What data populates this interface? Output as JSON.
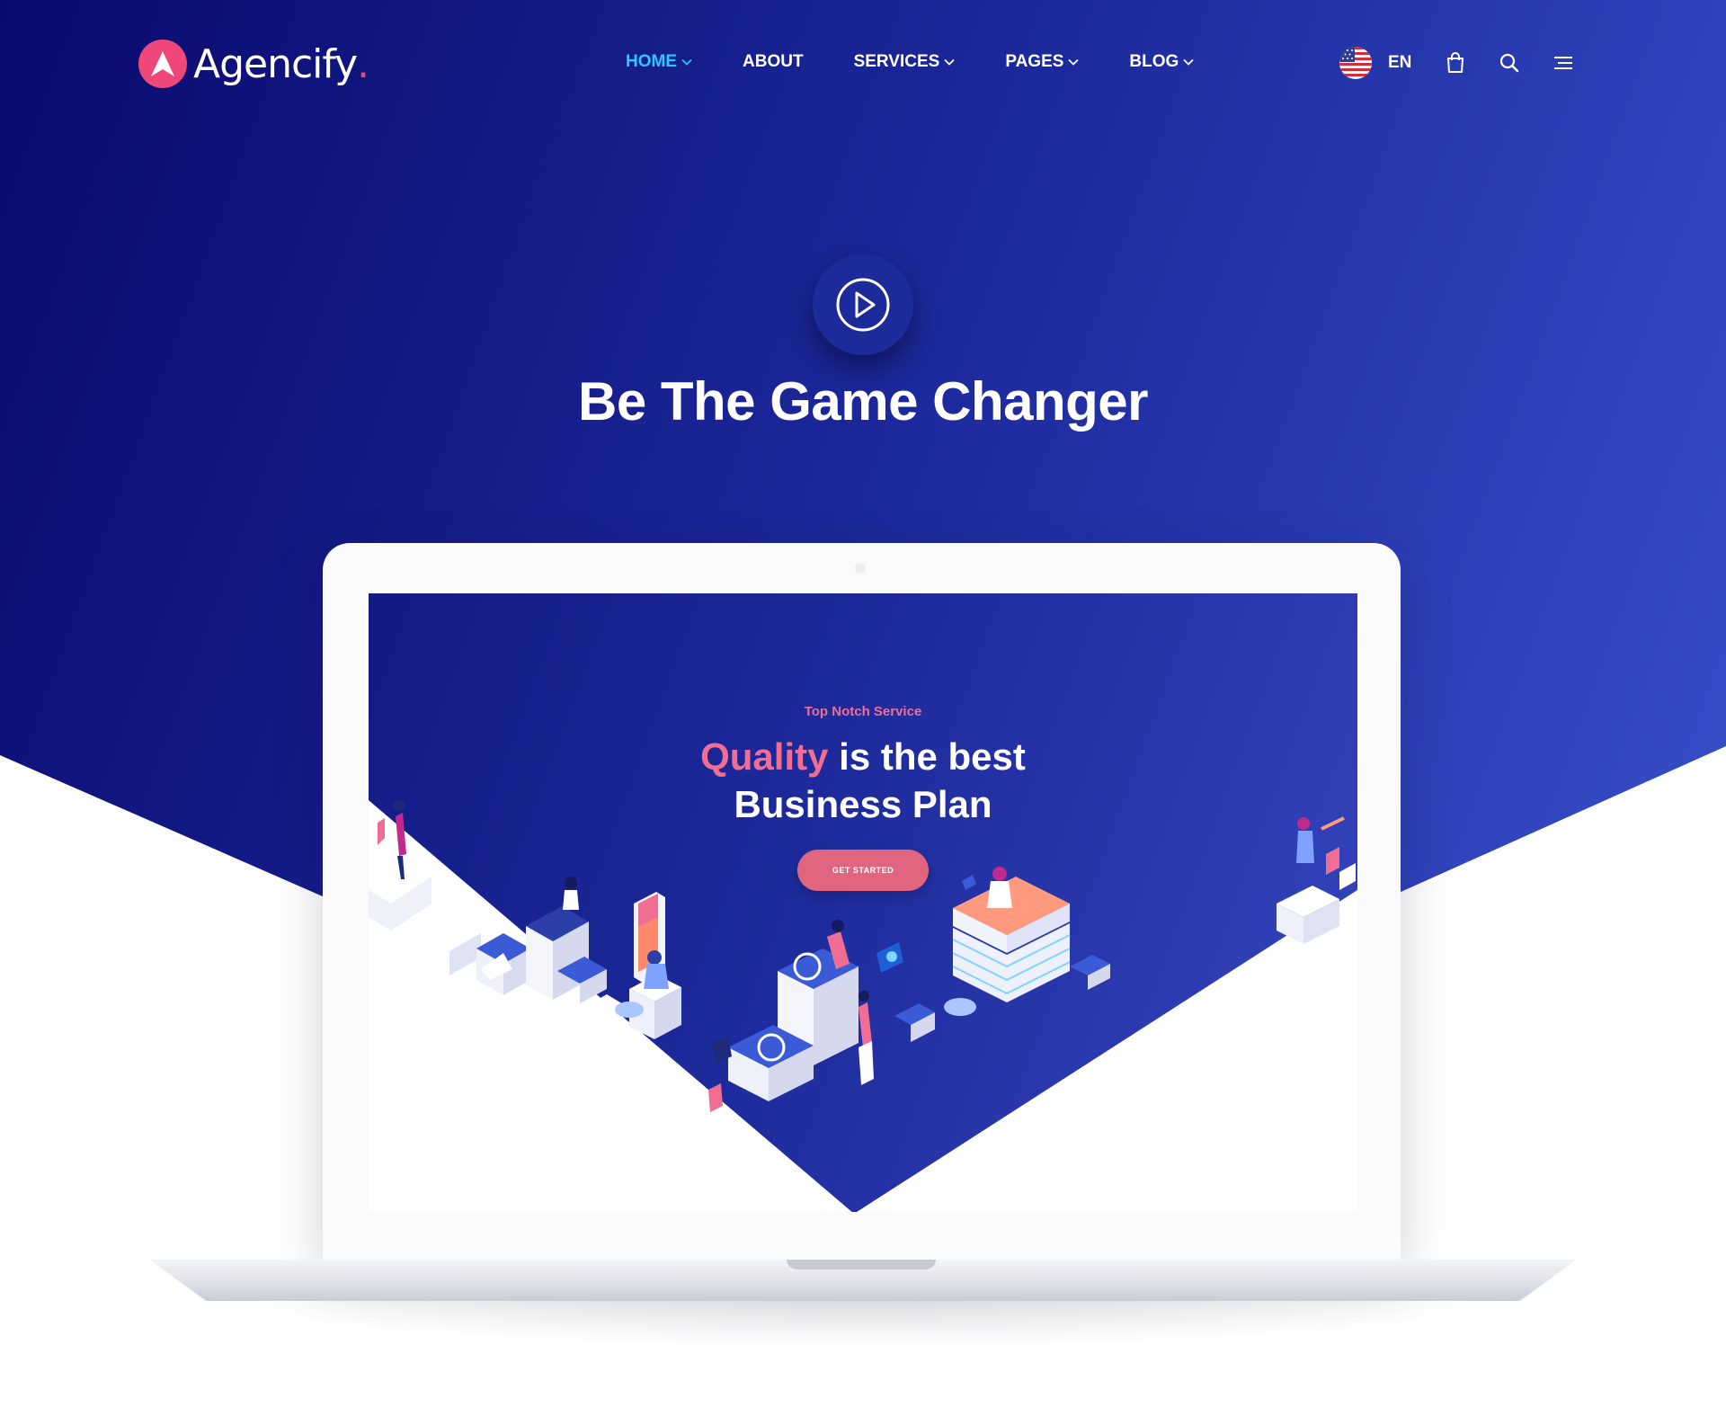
{
  "brand": {
    "name": "Agencify",
    "dot": ".",
    "accent_color": "#f0477a"
  },
  "nav": {
    "items": [
      {
        "label": "HOME",
        "has_dropdown": true,
        "active": true
      },
      {
        "label": "ABOUT",
        "has_dropdown": false,
        "active": false
      },
      {
        "label": "SERVICES",
        "has_dropdown": true,
        "active": false
      },
      {
        "label": "PAGES",
        "has_dropdown": true,
        "active": false
      },
      {
        "label": "BLOG",
        "has_dropdown": true,
        "active": false
      }
    ],
    "active_color": "#2fc5ff"
  },
  "header_right": {
    "language": "EN",
    "icons": [
      "us-flag-icon",
      "shopping-bag-icon",
      "search-icon",
      "menu-icon"
    ]
  },
  "hero": {
    "play_icon": "play-icon",
    "title": "Be The Game Changer",
    "gradient": [
      "#0a0a6e",
      "#1b2799",
      "#3c55d0"
    ]
  },
  "screen": {
    "eyebrow": "Top Notch Service",
    "headline_accent": "Quality",
    "headline_rest": " is the best",
    "headline_line2": "Business Plan",
    "cta_label": "GET STARTED",
    "accent_color": "#f06e93"
  }
}
